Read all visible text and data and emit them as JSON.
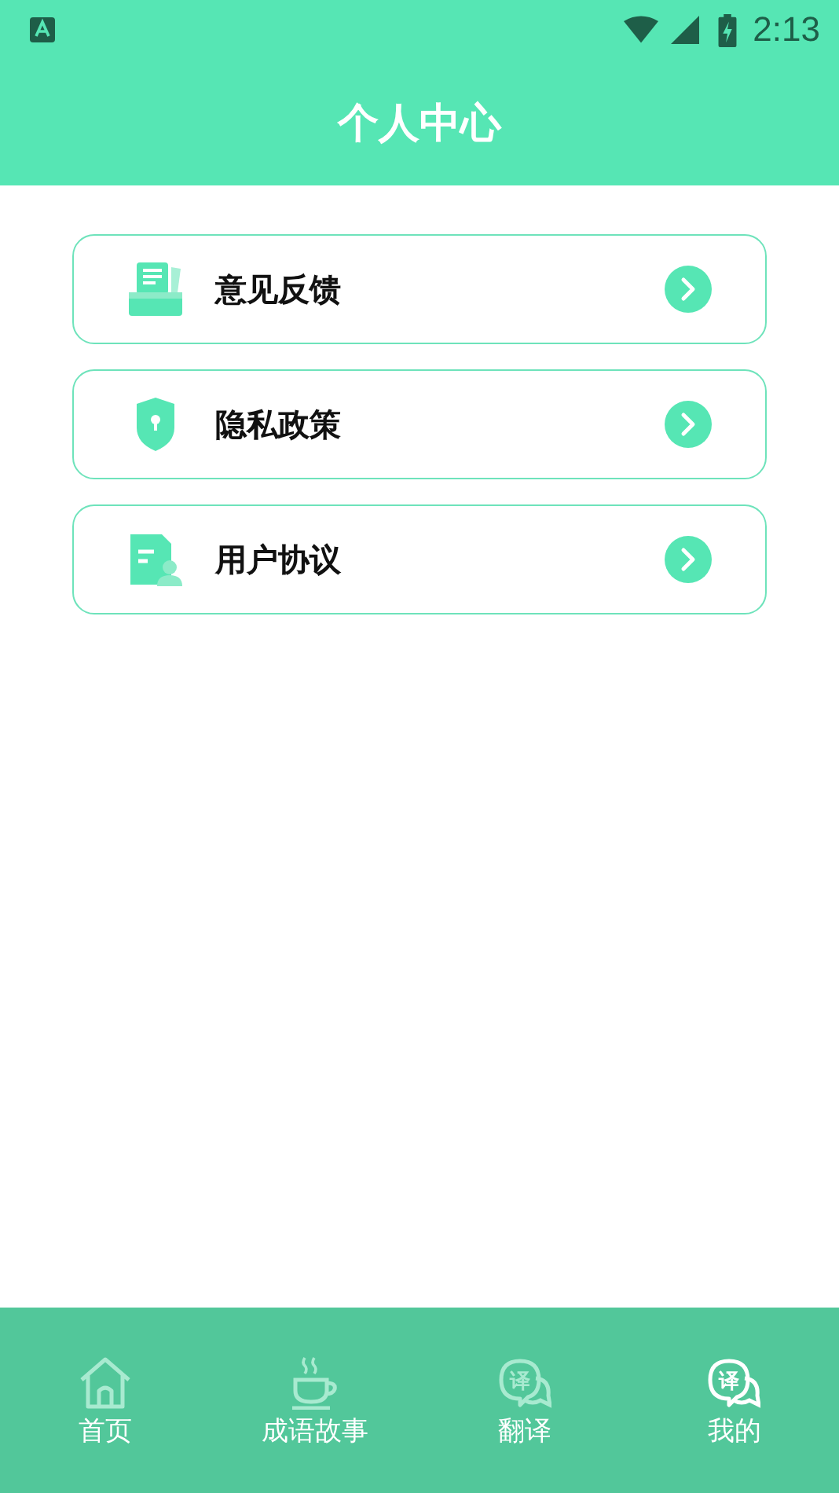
{
  "status_bar": {
    "time": "2:13"
  },
  "header": {
    "title": "个人中心"
  },
  "menu": [
    {
      "label": "意见反馈",
      "kind": "feedback"
    },
    {
      "label": "隐私政策",
      "kind": "privacy"
    },
    {
      "label": "用户协议",
      "kind": "agreement"
    }
  ],
  "tab_bar": [
    {
      "label": "首页",
      "kind": "home",
      "selected": false
    },
    {
      "label": "成语故事",
      "kind": "cup",
      "selected": false
    },
    {
      "label": "翻译",
      "kind": "translate",
      "glyph": "译",
      "selected": false
    },
    {
      "label": "我的",
      "kind": "translate",
      "glyph": "译",
      "selected": true
    }
  ]
}
